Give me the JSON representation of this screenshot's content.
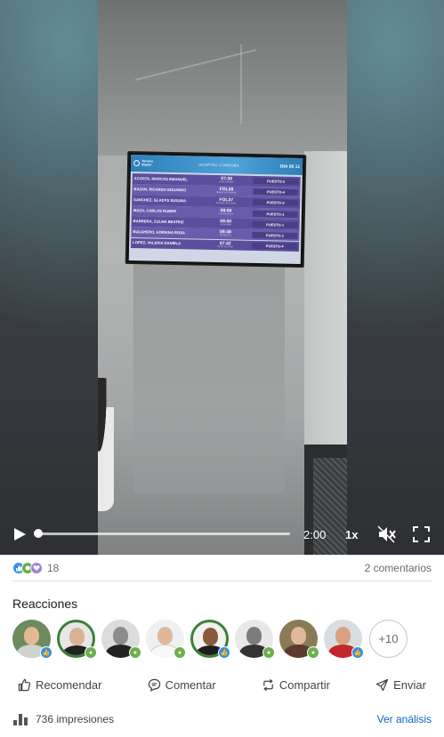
{
  "video": {
    "tv": {
      "logo_text": "Turnero Digital",
      "header_title": "HOSPITAL CORDOBA",
      "header_date": "DIA 05 11",
      "rows": [
        {
          "name": "ACOSTA, MARCOS EMANUEL",
          "time": "07:30",
          "dept": "PROLOGISMO",
          "place": "PUESTO-2"
        },
        {
          "name": "BAZAN, RICARDO EDUARDO",
          "time": "FOL38",
          "dept": "NOBNA VACUNAMIE",
          "place": "PUESTO-4"
        },
        {
          "name": "SANCHEZ, GLADYS SUSANA",
          "time": "FOL37",
          "dept": "MUNDIN VACUNAM",
          "place": "PUESTO-3"
        },
        {
          "name": "MAZA, CARLOS RUBER",
          "time": "08:00",
          "dept": "CARDIOLOGIA",
          "place": "PUESTO-1"
        },
        {
          "name": "BARRERA, ZULMA BEATRIZ",
          "time": "08:00",
          "dept": "PEDIATRIA",
          "place": "PUESTO-1"
        },
        {
          "name": "BULGHERO, ADRIANA ROSA",
          "time": "08:48",
          "dept": "REUMATOL",
          "place": "PUESTO-2"
        },
        {
          "name": "LOPEZ, VALERIA DANIELA",
          "time": "07:42",
          "dept": "ODONTOLOGIA",
          "place": "PUESTO-4"
        }
      ]
    },
    "controls": {
      "play_icon": "play-icon",
      "progress": 0.0,
      "time_remaining": "2:00",
      "speed": "1x",
      "mute_icon": "volume-muted-icon",
      "fullscreen_icon": "fullscreen-icon"
    }
  },
  "social": {
    "reaction_count": "18",
    "comments_label": "2 comentarios",
    "reaction_icons": [
      "like-icon",
      "support-icon",
      "love-icon"
    ]
  },
  "reactions": {
    "title": "Reacciones",
    "more_label": "+10"
  },
  "actions": {
    "recommend": "Recomendar",
    "comment": "Comentar",
    "share": "Compartir",
    "send": "Enviar"
  },
  "footer": {
    "impressions": "736 impresiones",
    "analytics": "Ver análisis"
  },
  "colors": {
    "link": "#0a66c2",
    "like_blue": "#378fe9",
    "support_green": "#6dae4f",
    "love_purple": "#9c81d8",
    "tv_row": "#5b4e9c",
    "tv_header": "#2c7fb8"
  }
}
